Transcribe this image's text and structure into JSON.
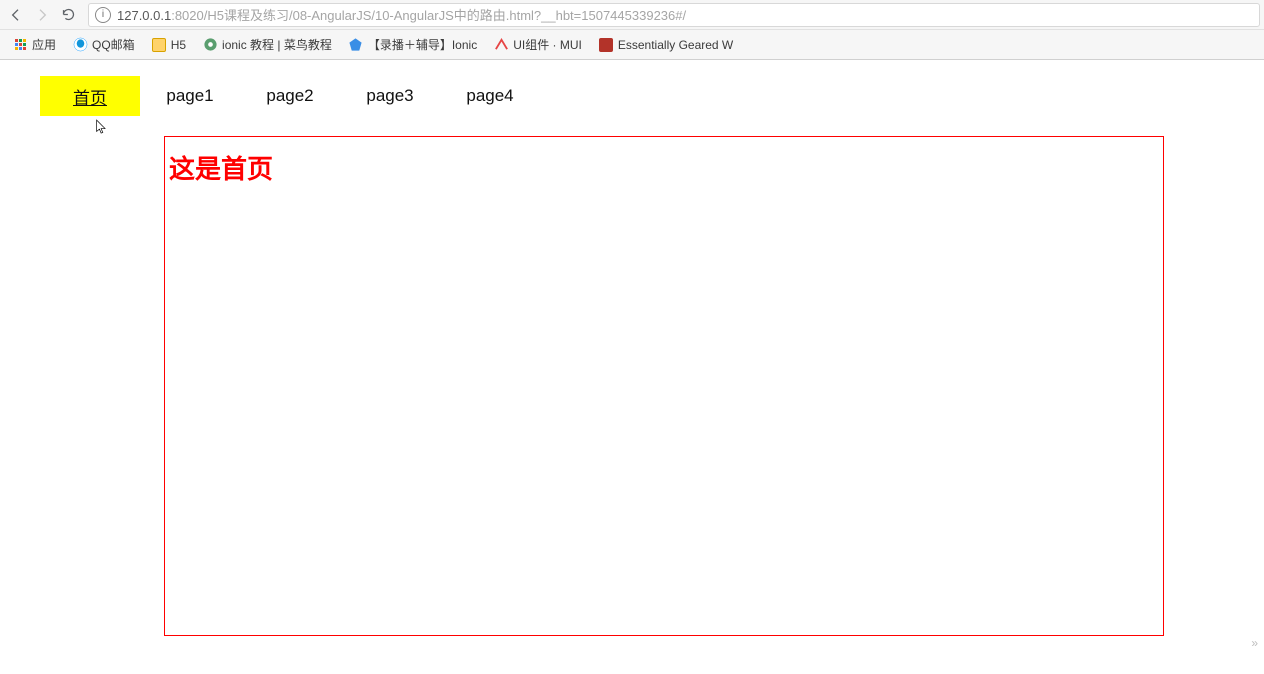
{
  "browser": {
    "url_host": "127.0.0.1",
    "url_port_path": ":8020/H5课程及练习/08-AngularJS/10-AngularJS中的路由.html?__hbt=1507445339236#/",
    "bookmarks": [
      {
        "label": "应用",
        "icon": "apps"
      },
      {
        "label": "QQ邮箱",
        "icon": "qq"
      },
      {
        "label": "H5",
        "icon": "folder"
      },
      {
        "label": "ionic 教程 | 菜鸟教程",
        "icon": "ionic"
      },
      {
        "label": "【录播＋辅导】Ionic",
        "icon": "diamond"
      },
      {
        "label": "UI组件 · MUI",
        "icon": "mui"
      },
      {
        "label": "Essentially Geared W",
        "icon": "eg"
      }
    ]
  },
  "tabs": [
    {
      "label": "首页",
      "active": true
    },
    {
      "label": "page1",
      "active": false
    },
    {
      "label": "page2",
      "active": false
    },
    {
      "label": "page3",
      "active": false
    },
    {
      "label": "page4",
      "active": false
    }
  ],
  "view_heading": "这是首页"
}
